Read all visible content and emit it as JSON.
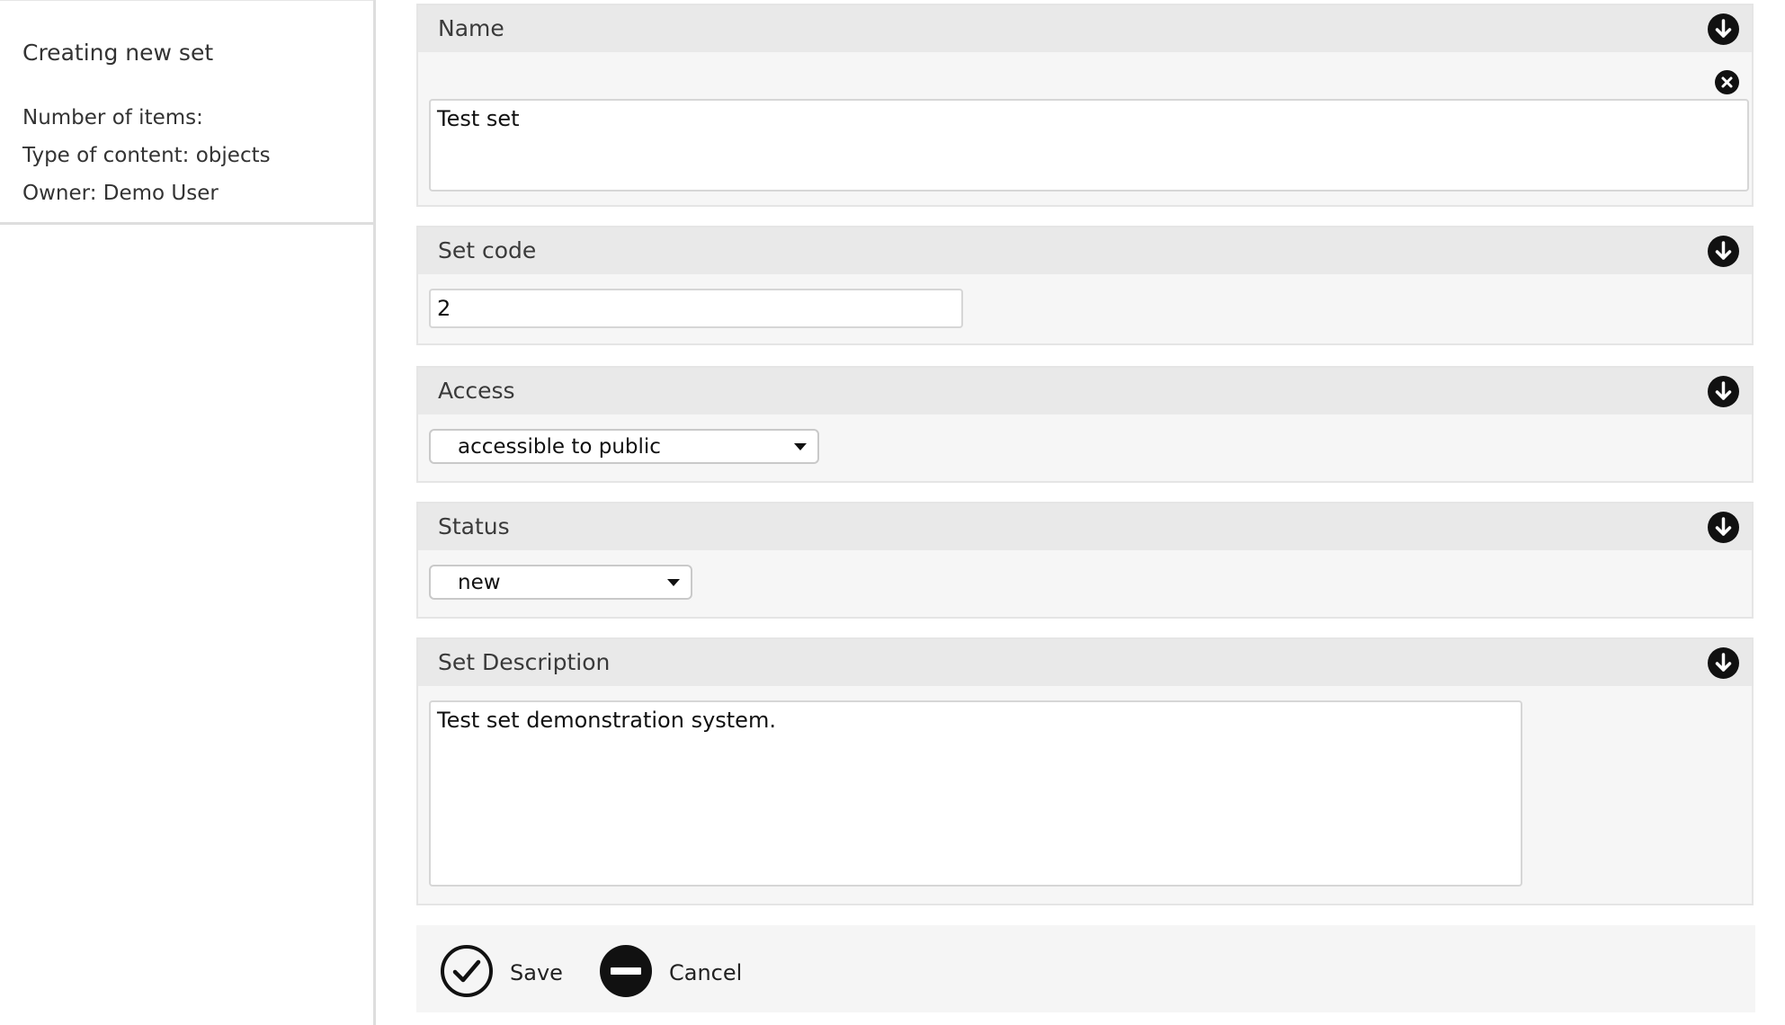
{
  "sidebar": {
    "title": "Creating new set",
    "number_of_items": "Number of items:",
    "type_of_content": "Type of content: objects",
    "owner": "Owner: Demo User"
  },
  "form": {
    "name": {
      "label": "Name",
      "value": "Test set"
    },
    "set_code": {
      "label": "Set code",
      "value": "2"
    },
    "access": {
      "label": "Access",
      "selected": "accessible to public"
    },
    "status": {
      "label": "Status",
      "selected": "new"
    },
    "description": {
      "label": "Set Description",
      "value": "Test set demonstration system."
    }
  },
  "actions": {
    "save_label": "Save",
    "cancel_label": "Cancel"
  },
  "icons": {
    "expand": "arrow-down-circle-icon",
    "clear": "close-circle-icon",
    "save": "check-circle-icon",
    "cancel": "minus-circle-icon"
  }
}
